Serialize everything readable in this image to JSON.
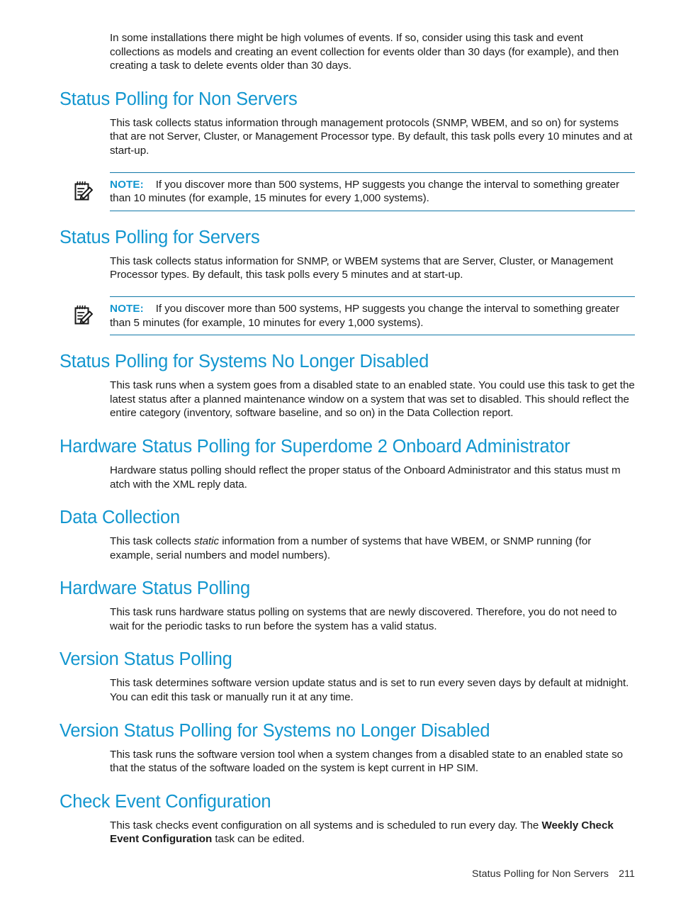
{
  "page": {
    "footer_title": "Status Polling for Non Servers",
    "footer_page_number": "211"
  },
  "colors": {
    "heading": "#1296cf",
    "note_rule": "#1278a8",
    "note_label": "#1296cf",
    "body_text": "#1c1c1c"
  },
  "intro": {
    "paragraph": "In some installations there might be high volumes of events. If so, consider using this task and event collections as models and creating an event collection for events older than 30 days (for example), and then creating a task to delete events older than 30 days."
  },
  "sections": [
    {
      "id": "status-polling-for-non-servers",
      "heading": "Status Polling for Non Servers",
      "paragraph": "This task collects status information through management protocols (SNMP, WBEM, and so on) for systems that are not Server, Cluster, or Management Processor type. By default, this task polls every 10 minutes and at start-up.",
      "note": {
        "label": "NOTE:",
        "text": "If you discover more than 500 systems, HP suggests you change the interval to something greater than 10 minutes (for example, 15 minutes for every 1,000 systems).",
        "icon": "note-pencil-pad-icon"
      }
    },
    {
      "id": "status-polling-for-servers",
      "heading": "Status Polling for Servers",
      "paragraph": "This task collects status information for SNMP, or WBEM systems that are Server, Cluster, or Management Processor types. By default, this task polls every 5 minutes and at start-up.",
      "note": {
        "label": "NOTE:",
        "text": "If you discover more than 500 systems, HP suggests you change the interval to something greater than 5 minutes (for example, 10 minutes for every 1,000 systems).",
        "icon": "note-pencil-pad-icon"
      }
    },
    {
      "id": "status-polling-for-systems-no-longer-disabled",
      "heading": "Status Polling for Systems No Longer Disabled",
      "paragraph": "This task runs when a system goes from a disabled state to an enabled state. You could use this task to get the latest status after a planned maintenance window on a system that was set to disabled. This should reflect the entire category (inventory, software baseline, and so on) in the Data Collection report."
    },
    {
      "id": "hardware-status-polling-for-superdome-2-onboard-administrator",
      "heading": "Hardware Status Polling for Superdome 2 Onboard Administrator",
      "paragraph": "Hardware status polling should reflect the proper status of the Onboard Administrator and this status must m atch with the XML reply data."
    },
    {
      "id": "data-collection",
      "heading": "Data Collection",
      "paragraph_part1": "This task collects ",
      "paragraph_italic": "static",
      "paragraph_part2": " information from a number of systems that have WBEM, or SNMP running (for example, serial numbers and model numbers)."
    },
    {
      "id": "hardware-status-polling",
      "heading": "Hardware Status Polling",
      "paragraph": "This task runs hardware status polling on systems that are newly discovered. Therefore, you do not need to wait for the periodic tasks to run before the system has a valid status."
    },
    {
      "id": "version-status-polling",
      "heading": "Version Status Polling",
      "paragraph": "This task determines software version update status and is set to run every seven days by default at midnight. You can edit this task or manually run it at any time."
    },
    {
      "id": "version-status-polling-for-systems-no-longer-disabled",
      "heading": "Version Status Polling for Systems no Longer Disabled",
      "paragraph": "This task runs the software version tool when a system changes from a disabled state to an enabled state so that the status of the software loaded on the system is kept current in HP SIM."
    },
    {
      "id": "check-event-configuration",
      "heading": "Check Event Configuration",
      "paragraph_part1": "This task checks event configuration on all systems and is scheduled to run every day. The ",
      "paragraph_bold": "Weekly Check Event Configuration",
      "paragraph_part2": " task can be edited."
    }
  ]
}
